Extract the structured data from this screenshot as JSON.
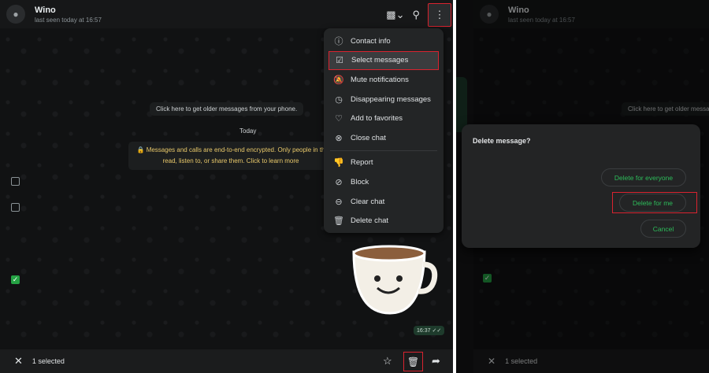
{
  "contact": {
    "name": "Wino",
    "status": "last seen today at 16:57"
  },
  "chat": {
    "older": "Click here to get older messages from your phone.",
    "today": "Today",
    "encryption_line1": "Messages and calls are end-to-end encrypted. Only people in th",
    "encryption_line2": "read, listen to, or share them. Click to learn more",
    "time": "16:37"
  },
  "menu": [
    {
      "label": "Contact info",
      "icon": "info-icon"
    },
    {
      "label": "Select messages",
      "icon": "check-square-icon",
      "highlighted": true
    },
    {
      "label": "Mute notifications",
      "icon": "bell-off-icon"
    },
    {
      "label": "Disappearing messages",
      "icon": "timer-icon"
    },
    {
      "label": "Add to favorites",
      "icon": "heart-icon"
    },
    {
      "label": "Close chat",
      "icon": "close-circle-icon"
    },
    {
      "label": "Report",
      "icon": "thumbs-down-icon"
    },
    {
      "label": "Block",
      "icon": "block-icon"
    },
    {
      "label": "Clear chat",
      "icon": "minus-circle-icon"
    },
    {
      "label": "Delete chat",
      "icon": "trash-icon"
    }
  ],
  "selection": {
    "count": "1 selected"
  },
  "dialog": {
    "title": "Delete message?",
    "everyone": "Delete for everyone",
    "me": "Delete for me",
    "cancel": "Cancel"
  },
  "right_chat": {
    "older": "Click here to get older messages from your phone."
  },
  "colors": {
    "accent": "#25a244",
    "highlight": "#d8232f",
    "background": "#111213"
  }
}
